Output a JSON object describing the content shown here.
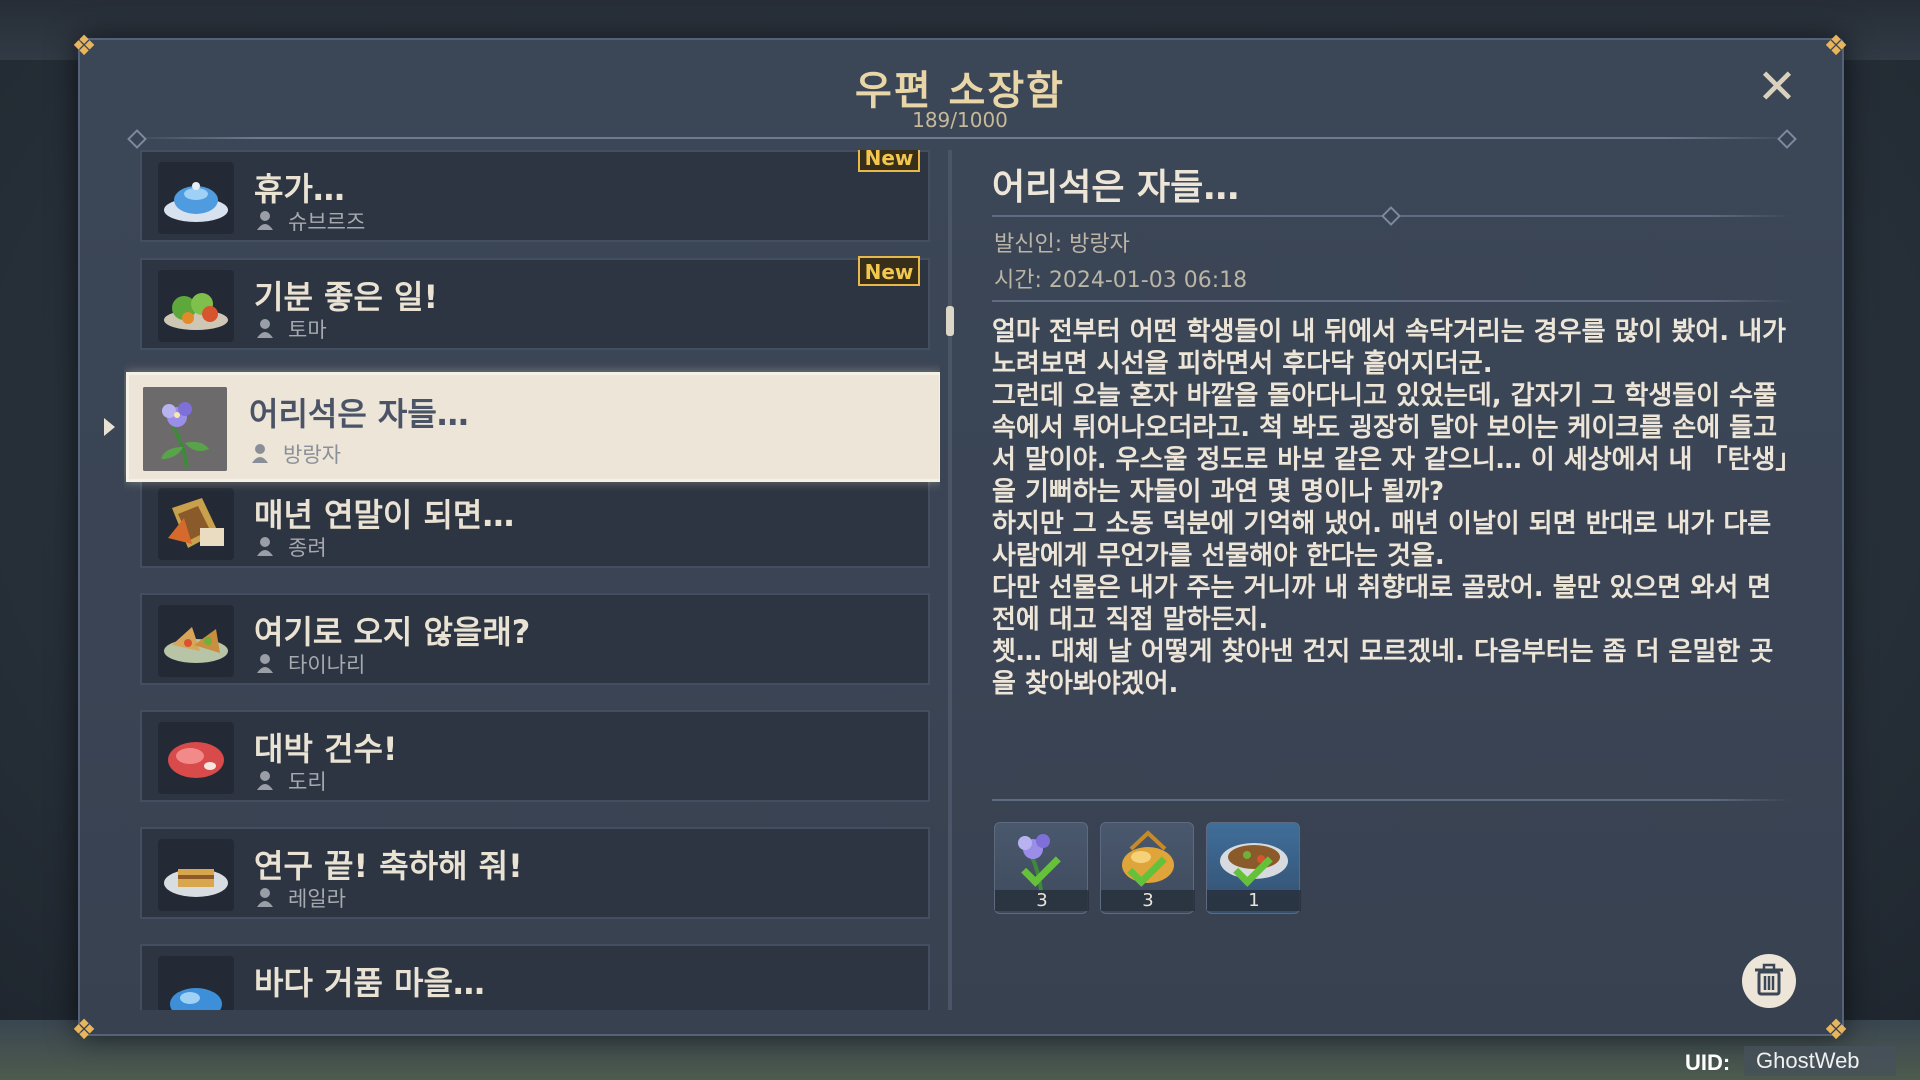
{
  "header": {
    "title": "우편 소장함",
    "count": "189/1000",
    "close_icon": "close-icon"
  },
  "mail_list": {
    "items": [
      {
        "title": "휴가…",
        "sender": "슈브르즈",
        "new_label": "New",
        "thumb_icon": "teapot-icon"
      },
      {
        "title": "기분 좋은 일!",
        "sender": "토마",
        "new_label": "New",
        "thumb_icon": "salad-icon"
      },
      {
        "title": "어리석은 자들…",
        "sender": "방랑자",
        "new_label": "",
        "thumb_icon": "flower-icon",
        "selected": true
      },
      {
        "title": "매년 연말이 되면…",
        "sender": "종려",
        "new_label": "",
        "thumb_icon": "snack-bundle-icon"
      },
      {
        "title": "여기로 오지 않을래?",
        "sender": "타이나리",
        "new_label": "",
        "thumb_icon": "wrap-dish-icon"
      },
      {
        "title": "대박 건수!",
        "sender": "도리",
        "new_label": "",
        "thumb_icon": "meat-icon"
      },
      {
        "title": "연구 끝! 축하해 줘!",
        "sender": "레일라",
        "new_label": "",
        "thumb_icon": "cake-icon"
      },
      {
        "title": "바다 거품 마을…",
        "sender": "",
        "new_label": "",
        "thumb_icon": "jelly-icon"
      }
    ]
  },
  "detail": {
    "title": "어리석은 자들…",
    "sender_line": "발신인: 방랑자",
    "time_line": "시간: 2024-01-03 06:18",
    "body": [
      "얼마 전부터 어떤 학생들이 내 뒤에서 속닥거리는 경우를 많이 봤어. 내가 노려보면 시선을 피하면서 후다닥 흩어지더군.",
      "그런데 오늘 혼자 바깥을 돌아다니고 있었는데, 갑자기 그 학생들이 수풀 속에서 튀어나오더라고. 척 봐도 굉장히 달아 보이는 케이크를 손에 들고서 말이야. 우스울 정도로 바보 같은 자 같으니… 이 세상에서 내 「탄생」을 기뻐하는 자들이 과연 몇 명이나 될까?",
      "하지만 그 소동 덕분에 기억해 냈어. 매년 이날이 되면 반대로 내가 다른 사람에게 무언가를 선물해야 한다는 것을.",
      "다만 선물은 내가 주는 거니까 내 취향대로 골랐어. 불만 있으면 와서 면전에 대고 직접 말하든지.",
      "쳇… 대체 날 어떻게 찾아낸 건지 모르겠네. 다음부터는 좀 더 은밀한 곳을 찾아봐야겠어."
    ],
    "attachments": [
      {
        "icon": "flower-icon",
        "qty": "3",
        "claimed": true
      },
      {
        "icon": "golden-dumpling-icon",
        "qty": "3",
        "claimed": true
      },
      {
        "icon": "soup-bowl-icon",
        "qty": "1",
        "claimed": true
      }
    ],
    "trash_icon": "trash-icon"
  },
  "footer": {
    "uid_label": "UID:",
    "uid_value": "GhostWeb"
  },
  "colors": {
    "accent_gold": "#e8b84a",
    "panel_bg": "#3b4656",
    "selected_bg": "#ece5d8",
    "text_light": "#ece5d8"
  }
}
